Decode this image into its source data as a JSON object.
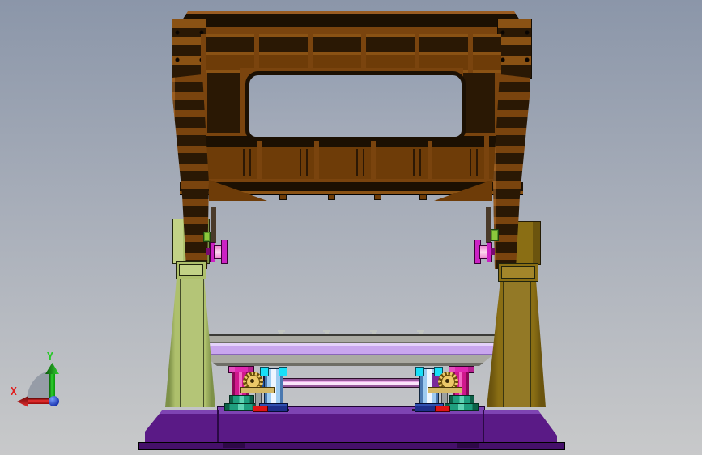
{
  "scene": {
    "description": "3D CAD viewport, front orthographic view of a press frame assembly",
    "bg_top": "#8b96a9",
    "bg_mid": "#a9afba",
    "bg_bottom": "#c8c9ca"
  },
  "axis_triad": {
    "x_label": "X",
    "y_label": "Y",
    "x_color": "#e02020",
    "y_color": "#28c828",
    "z_color": "#2846c8",
    "fan_color": "rgba(128,136,150,0.65)"
  },
  "palette": {
    "bgTop": "#8b96a9",
    "bgMid": "#a9afba",
    "bgBottom": "#c8c9ca",
    "fanColor": "rgba(128,136,150,0.65)",
    "axisX": "#e02020",
    "axisY": "#28c828",
    "crownFace": "#7a440e",
    "crownLight": "#8a5214",
    "crownPanel": "#6e3c08",
    "crownDark": "#2a1804",
    "crownDarker": "#1c1002",
    "crownEdge": "#9a5c22",
    "windowSkyTop": "#98a2b3",
    "windowSkyBottom": "#a4abb9",
    "colLeftFace": "#aec06c",
    "colLeftLight": "#c2d286",
    "colLeftDark": "#7e9148",
    "colRightFace": "#8a6e14",
    "colRightLight": "#a3862a",
    "colRightDark": "#6b540e",
    "crankMagenta": "#cc22c4",
    "crankPink": "#ee8ad2",
    "crankPale": "#fbd8ee",
    "crankDark": "#7a0a70",
    "greenBlock": "#8cc83c",
    "tableLav": "#c9a6ee",
    "tableLavLight": "#e4d2fa",
    "grayBeam": "#aaaaa2",
    "grayBeamDark": "#6e6e66",
    "boltGray": "#c2c6c0",
    "jackMagenta": "#d0188c",
    "jackMagentaHi": "#f468c4",
    "jackMagentaDark": "#8a0858",
    "flangeMagenta": "#e028b0",
    "teal": "#1f9e7e",
    "tealHi": "#5fd4b4",
    "tealDark": "#0c6148",
    "gearYellow": "#ecc968",
    "gearDark": "#6a4f0a",
    "tanBracket": "#d4b968",
    "grayPost": "#9aa0a0",
    "blueCyl": "#9ecbf0",
    "blueCylHi": "#eef6ff",
    "blueCylDark": "#4a78b0",
    "cyanBlock": "#18dff8",
    "navyBase": "#1d2f8a",
    "redStrip": "#e01414",
    "purpleBit": "#7a2a9a",
    "shaftPink": "#eaaae8",
    "shaftPinkHi": "#fbe4fa",
    "shaftPinkDark": "#96589a",
    "basePurple": "#5a1a86",
    "basePurpleLight": "#7e44b3",
    "basePurpleDark": "#45106a"
  }
}
